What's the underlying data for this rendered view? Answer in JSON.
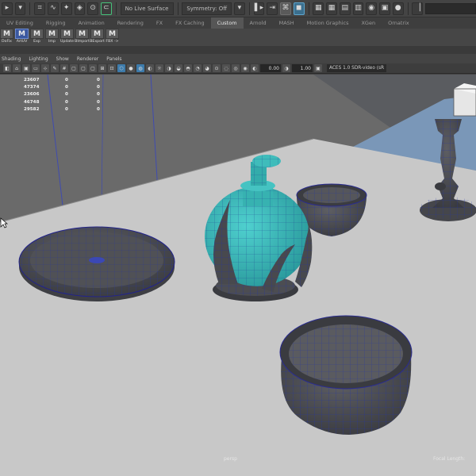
{
  "statusline": {
    "live_surface": "No Live Surface",
    "symmetry": "Symmetry: Off"
  },
  "shelf_tabs": [
    "UV Editing",
    "Rigging",
    "Animation",
    "Rendering",
    "FX",
    "FX Caching",
    "Custom",
    "Arnold",
    "MASH",
    "Motion Graphics",
    "XGen",
    "Ornatrix"
  ],
  "shelf_tabs_active": "Custom",
  "shelf_buttons": [
    {
      "glyph": "M",
      "caption": "DoFix",
      "icon": "mel-script-icon"
    },
    {
      "glyph": "M",
      "caption": "ArtUV",
      "icon": "mel-script-icon",
      "highlight": true
    },
    {
      "glyph": "M",
      "caption": "Exp",
      "icon": "mel-script-icon"
    },
    {
      "glyph": "M",
      "caption": "Imp",
      "icon": "mel-script-icon"
    },
    {
      "glyph": "M",
      "caption": "Update",
      "icon": "mel-script-icon"
    },
    {
      "glyph": "M",
      "caption": "BImport",
      "icon": "mel-script-icon"
    },
    {
      "glyph": "M",
      "caption": "BExport",
      "icon": "mel-script-icon"
    },
    {
      "glyph": "M",
      "caption": "FBX ->",
      "icon": "mel-script-icon"
    }
  ],
  "panel_menu": [
    "Shading",
    "Lighting",
    "Show",
    "Renderer",
    "Panels"
  ],
  "panel_toolbar": {
    "value_a": "0.00",
    "value_b": "1.00",
    "color_space": "ACES 1.0 SDR-video (sR"
  },
  "hud_rows": [
    [
      "23607",
      "0",
      "0"
    ],
    [
      "47374",
      "0",
      "0"
    ],
    [
      "23606",
      "0",
      "0"
    ],
    [
      "46748",
      "0",
      "0"
    ],
    [
      "29582",
      "0",
      "0"
    ]
  ],
  "viewport": {
    "camera": "persp",
    "focal_length_label": "Focal Length:",
    "colors": {
      "floor": "#c8c8c8",
      "mesh_dark": "#4d4e52",
      "wire": "#2233aa",
      "bottle": "#36b0b0",
      "background": "#6b6b6b"
    }
  }
}
